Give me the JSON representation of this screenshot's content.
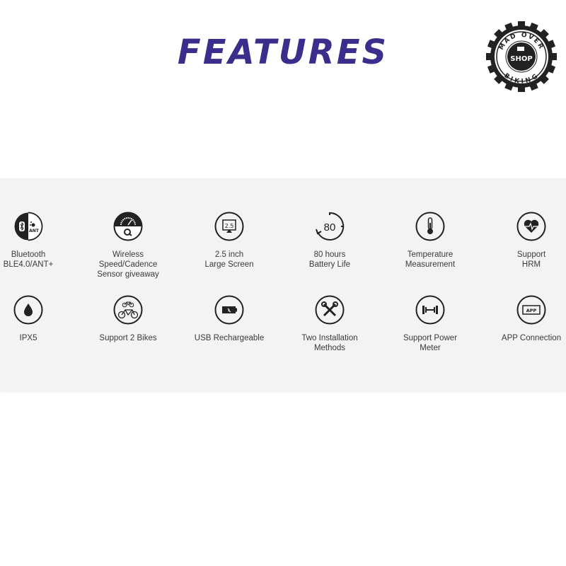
{
  "header": {
    "title": "FEATURES"
  },
  "logo": {
    "top_text": "MAD OVER",
    "center_text": "SHOP",
    "bottom_text": "BIKING"
  },
  "colors": {
    "title": "#3a2e8c",
    "panel_bg": "#f3f3f3",
    "icon": "#222222",
    "label": "#3a3a3a"
  },
  "features": [
    {
      "icon": "bluetooth-ant-icon",
      "lines": [
        "Bluetooth",
        "BLE4.0/ANT+"
      ]
    },
    {
      "icon": "speed-cadence-sensor-icon",
      "lines": [
        "Wireless",
        "Speed/Cadence",
        "Sensor giveaway"
      ]
    },
    {
      "icon": "screen-icon",
      "icon_text": "2.5",
      "lines": [
        "2.5 inch",
        "Large Screen"
      ]
    },
    {
      "icon": "battery-timer-icon",
      "icon_text": "80",
      "lines": [
        "80 hours",
        "Battery Life"
      ]
    },
    {
      "icon": "thermometer-icon",
      "lines": [
        "Temperature",
        "Measurement"
      ]
    },
    {
      "icon": "heart-rate-icon",
      "lines": [
        "Support",
        "HRM"
      ]
    },
    {
      "icon": "water-drop-icon",
      "lines": [
        "IPX5"
      ]
    },
    {
      "icon": "two-bikes-icon",
      "lines": [
        "Support 2 Bikes"
      ]
    },
    {
      "icon": "battery-charging-icon",
      "lines": [
        "USB Rechargeable"
      ]
    },
    {
      "icon": "tools-icon",
      "lines": [
        "Two Installation",
        "Methods"
      ]
    },
    {
      "icon": "power-meter-icon",
      "lines": [
        "Support Power",
        "Meter"
      ]
    },
    {
      "icon": "app-icon",
      "icon_text": "APP",
      "lines": [
        "APP Connection"
      ]
    }
  ]
}
